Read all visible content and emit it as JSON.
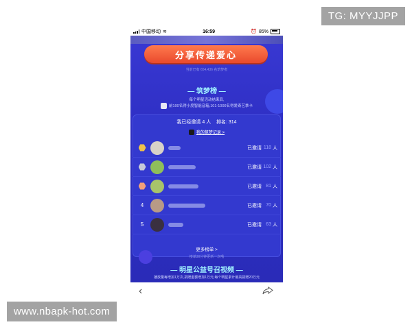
{
  "watermarks": {
    "top_right": "TG: MYYJJPP",
    "bottom_left": "www.nbapk-hot.com"
  },
  "status_bar": {
    "carrier": "中国移动",
    "time": "16:59",
    "battery": "85%"
  },
  "share": {
    "button_label": "分享传递爱心",
    "invited_total": "当前已有 654,436 名筑梦者"
  },
  "leaderboard": {
    "title": "— 筑梦榜 —",
    "rules_line1": "每个明星活动结束后,",
    "rules_line2": "前100名得小度智能音箱,101-1000名得爱奇艺季卡",
    "me_invited_text": "我已经邀请 4 人",
    "rank_text": "排名: 314",
    "record_link": "我的筑梦记录 >",
    "rows": [
      {
        "rank": "",
        "medal_color": "#f0c24a",
        "avatar_color": "#d8d2c8",
        "invited_label": "已邀请",
        "count": "118",
        "unit": "人"
      },
      {
        "rank": "",
        "medal_color": "#c6c9d8",
        "avatar_color": "#8fbf5a",
        "invited_label": "已邀请",
        "count": "102",
        "unit": "人"
      },
      {
        "rank": "",
        "medal_color": "#f2a07b",
        "avatar_color": "#a8c46a",
        "invited_label": "已邀请",
        "count": "81",
        "unit": "人"
      },
      {
        "rank": "4",
        "medal_color": "",
        "avatar_color": "#b89a86",
        "invited_label": "已邀请",
        "count": "70",
        "unit": "人"
      },
      {
        "rank": "5",
        "medal_color": "",
        "avatar_color": "#3a3040",
        "invited_label": "已邀请",
        "count": "63",
        "unit": "人"
      }
    ],
    "more_link": "更多榜单 >",
    "update_note": "榜单30分钟更新一次哦"
  },
  "section2": {
    "title": "— 明星公益号召视频 —",
    "note": "播放量每增加1万次,捐赠金额增加1万元,每个明星累计最高捐赠20万元"
  },
  "colors": {
    "accent": "#ff6a3d",
    "background": "#2e2fc4",
    "title": "#9ff0ff"
  }
}
